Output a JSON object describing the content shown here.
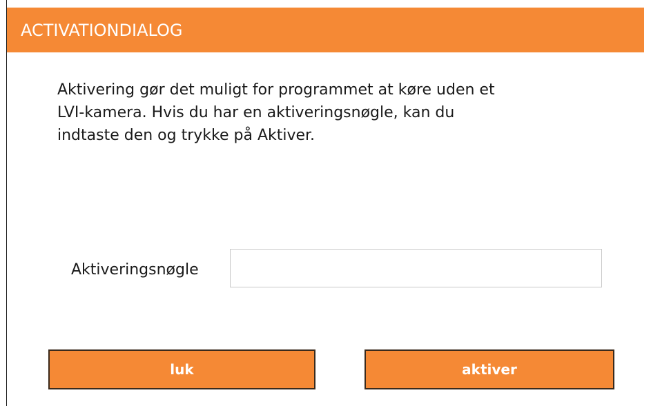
{
  "dialog": {
    "title": "ACTIVATIONDIALOG",
    "description_lines": [
      "Aktivering gør det muligt for programmet at køre uden et",
      "LVI-kamera. Hvis du har en aktiveringsnøgle, kan du",
      "indtaste den og trykke på Aktiver."
    ],
    "key_field": {
      "label": "Aktiveringsnøgle",
      "value": "",
      "placeholder": ""
    },
    "buttons": {
      "close_label": "luk",
      "activate_label": "aktiver"
    }
  },
  "colors": {
    "accent": "#f58935",
    "text": "#1a1a1a",
    "button_text": "#ffffff",
    "input_border": "#c8c8c8"
  }
}
